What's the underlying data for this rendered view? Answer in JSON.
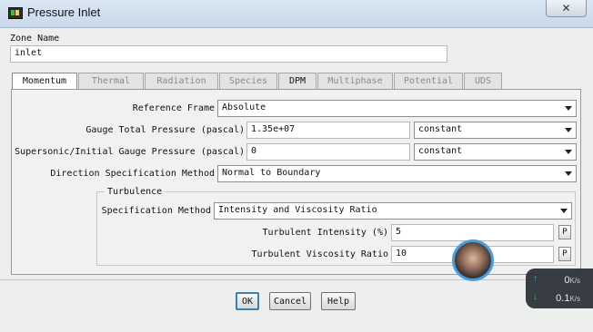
{
  "window": {
    "title": "Pressure Inlet",
    "close_glyph": "✕"
  },
  "zone": {
    "label": "Zone Name",
    "value": "inlet"
  },
  "tabs": [
    {
      "label": "Momentum",
      "active": true
    },
    {
      "label": "Thermal",
      "active": false
    },
    {
      "label": "Radiation",
      "active": false
    },
    {
      "label": "Species",
      "active": false
    },
    {
      "label": "DPM",
      "active": false
    },
    {
      "label": "Multiphase",
      "active": false
    },
    {
      "label": "Potential",
      "active": false
    },
    {
      "label": "UDS",
      "active": false
    }
  ],
  "momentum": {
    "reference_frame": {
      "label": "Reference Frame",
      "value": "Absolute"
    },
    "gauge_total_pressure": {
      "label": "Gauge Total Pressure (pascal)",
      "value": "1.35e+07",
      "method": "constant"
    },
    "supersonic_pressure": {
      "label": "Supersonic/Initial Gauge Pressure (pascal)",
      "value": "0",
      "method": "constant"
    },
    "direction_method": {
      "label": "Direction Specification Method",
      "value": "Normal to Boundary"
    },
    "turbulence": {
      "title": "Turbulence",
      "spec_method": {
        "label": "Specification Method",
        "value": "Intensity and Viscosity Ratio"
      },
      "intensity": {
        "label": "Turbulent Intensity (%)",
        "value": "5",
        "param": "P"
      },
      "viscosity_ratio": {
        "label": "Turbulent Viscosity Ratio",
        "value": "10",
        "param": "P"
      }
    }
  },
  "buttons": {
    "ok": "OK",
    "cancel": "Cancel",
    "help": "Help"
  },
  "net_speed": {
    "up": {
      "value": "0",
      "unit": "K/s",
      "icon": "↑"
    },
    "down": {
      "value": "0.1",
      "unit": "K/s",
      "icon": "↓"
    }
  },
  "colors": {
    "titlebar": "#c9d9ea",
    "ok_border": "#3c7fb1",
    "up_arrow": "#3fa7f0",
    "down_arrow": "#3cc46a"
  }
}
